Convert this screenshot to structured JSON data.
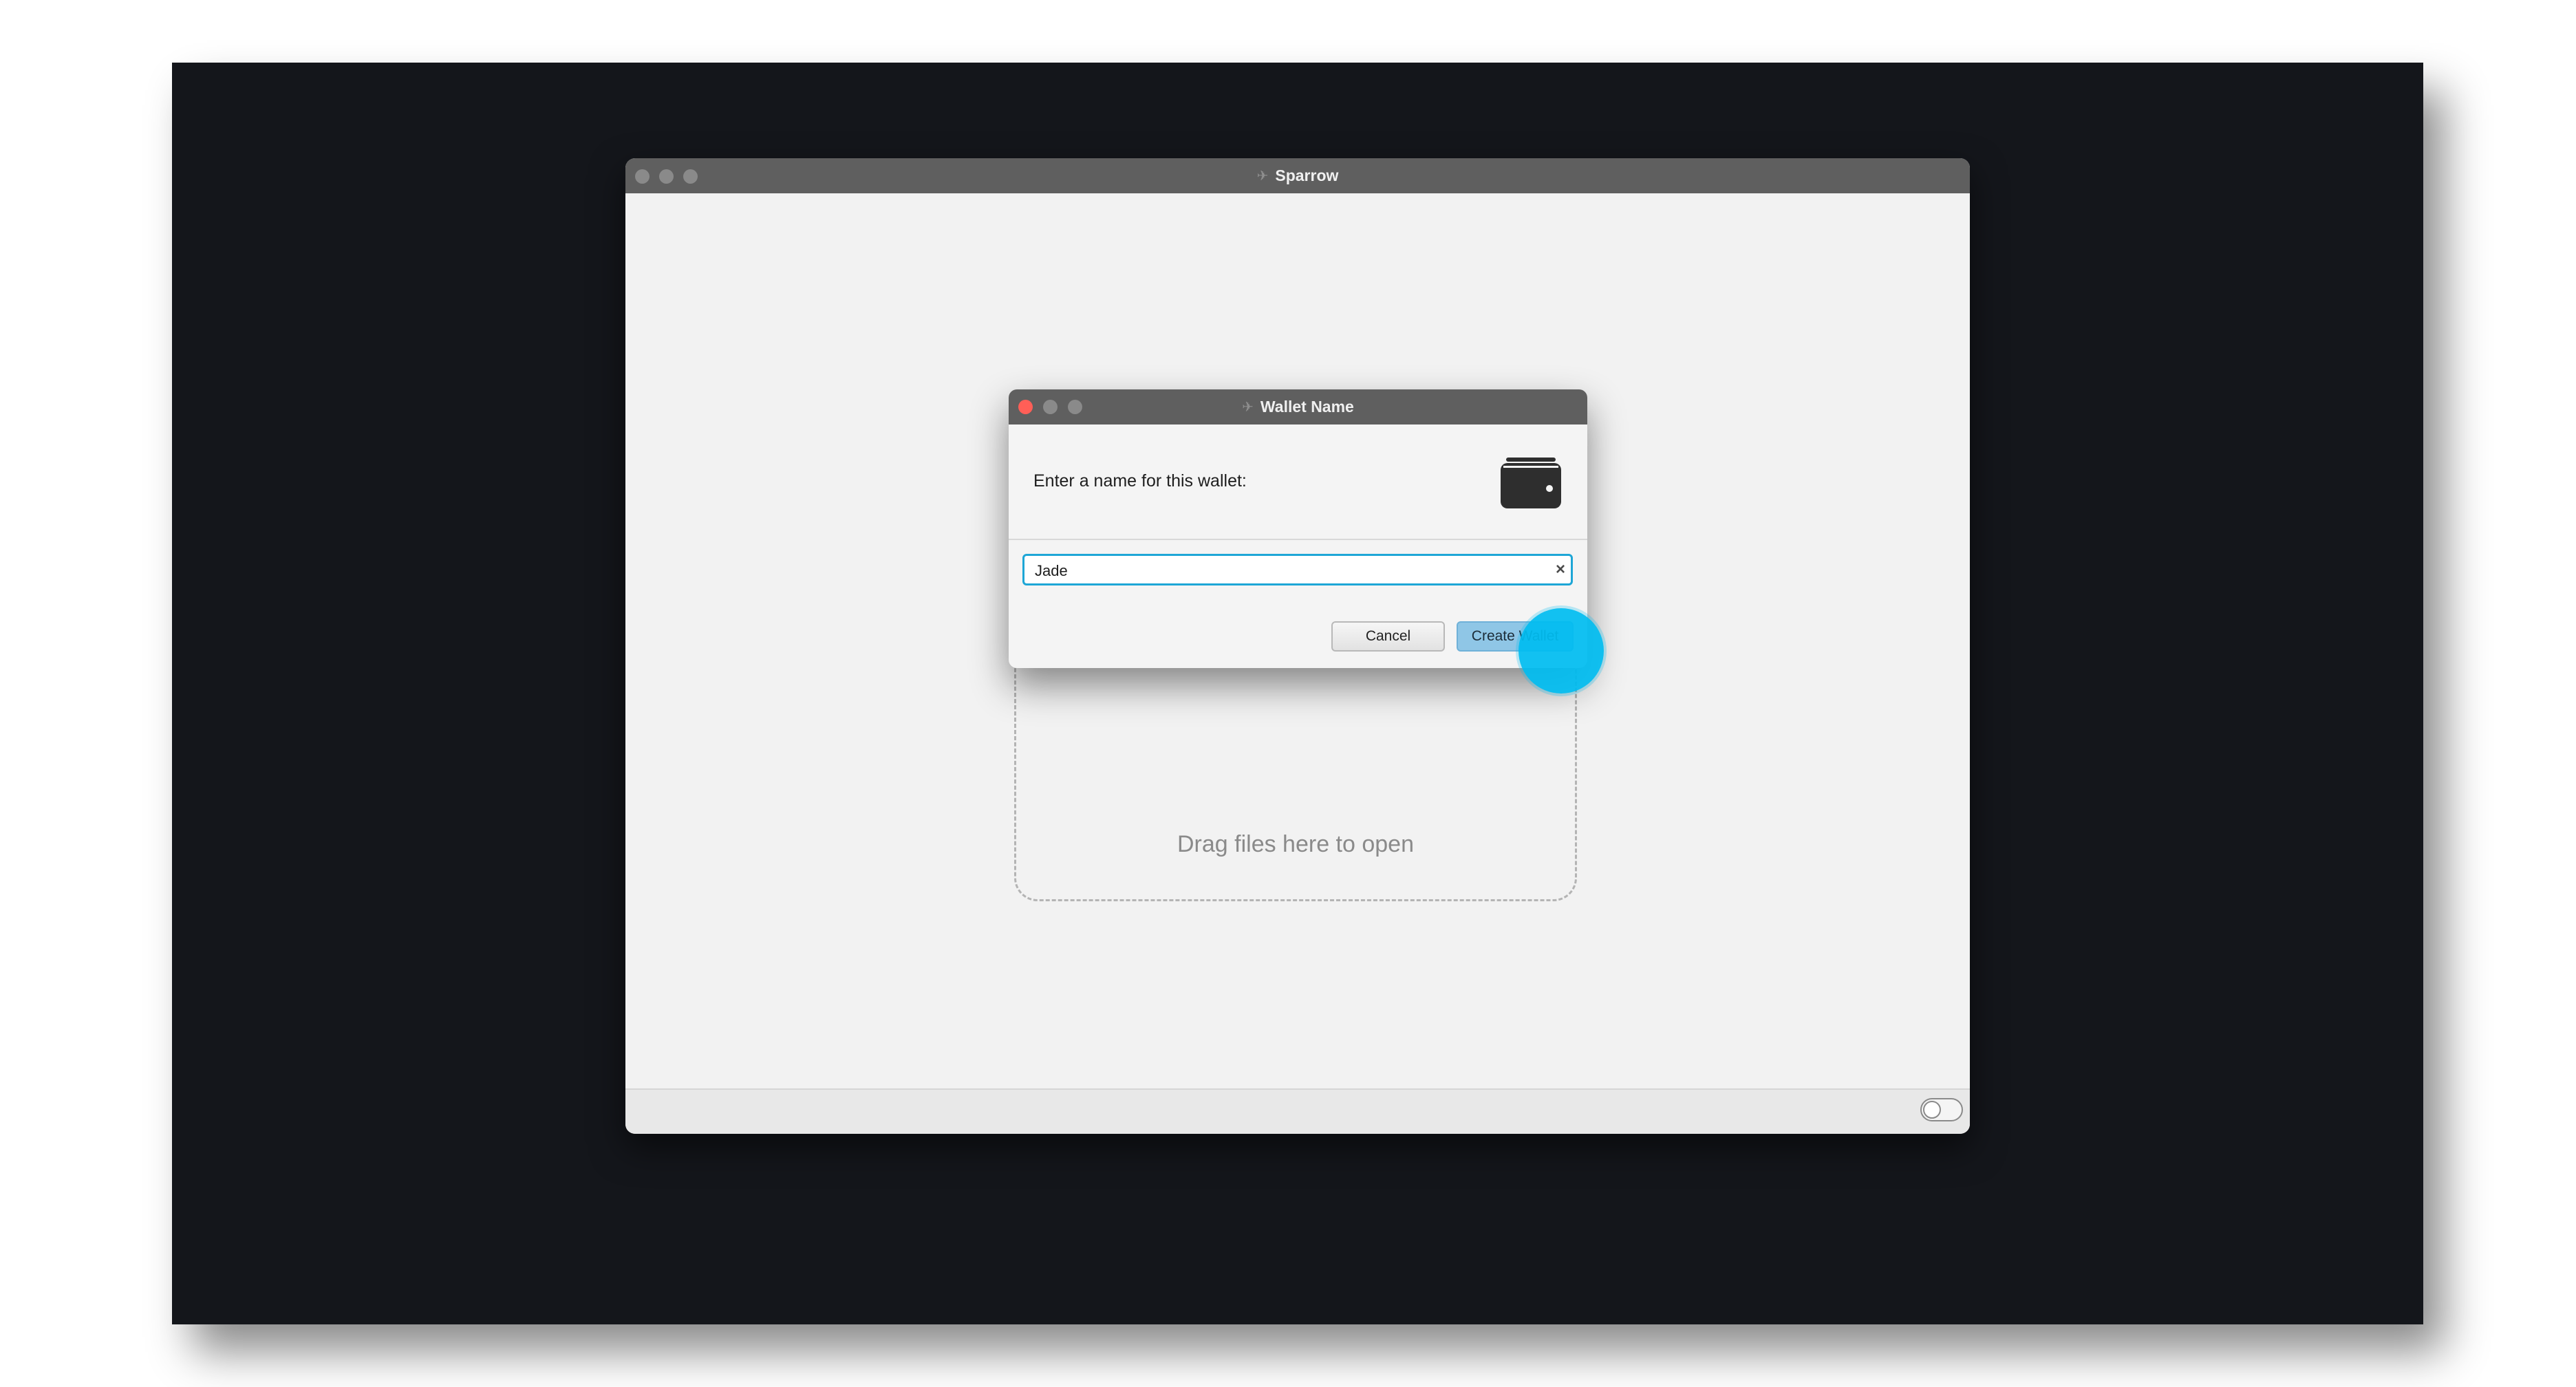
{
  "main_window": {
    "title": "Sparrow",
    "drop_zone_text": "Drag files here to open"
  },
  "dialog": {
    "title": "Wallet Name",
    "prompt": "Enter a name for this wallet:",
    "name_field": {
      "value": "Jade"
    },
    "buttons": {
      "cancel": "Cancel",
      "create": "Create Wallet"
    },
    "icons": {
      "header": "wallet-icon",
      "clear": "clear-icon"
    }
  },
  "colors": {
    "desktop_background": "#14161b",
    "titlebar": "#5f5f5f",
    "field_focus": "#1ea6d6",
    "primary_button": "#8fc6e6",
    "click_marker": "#00bcf0"
  }
}
